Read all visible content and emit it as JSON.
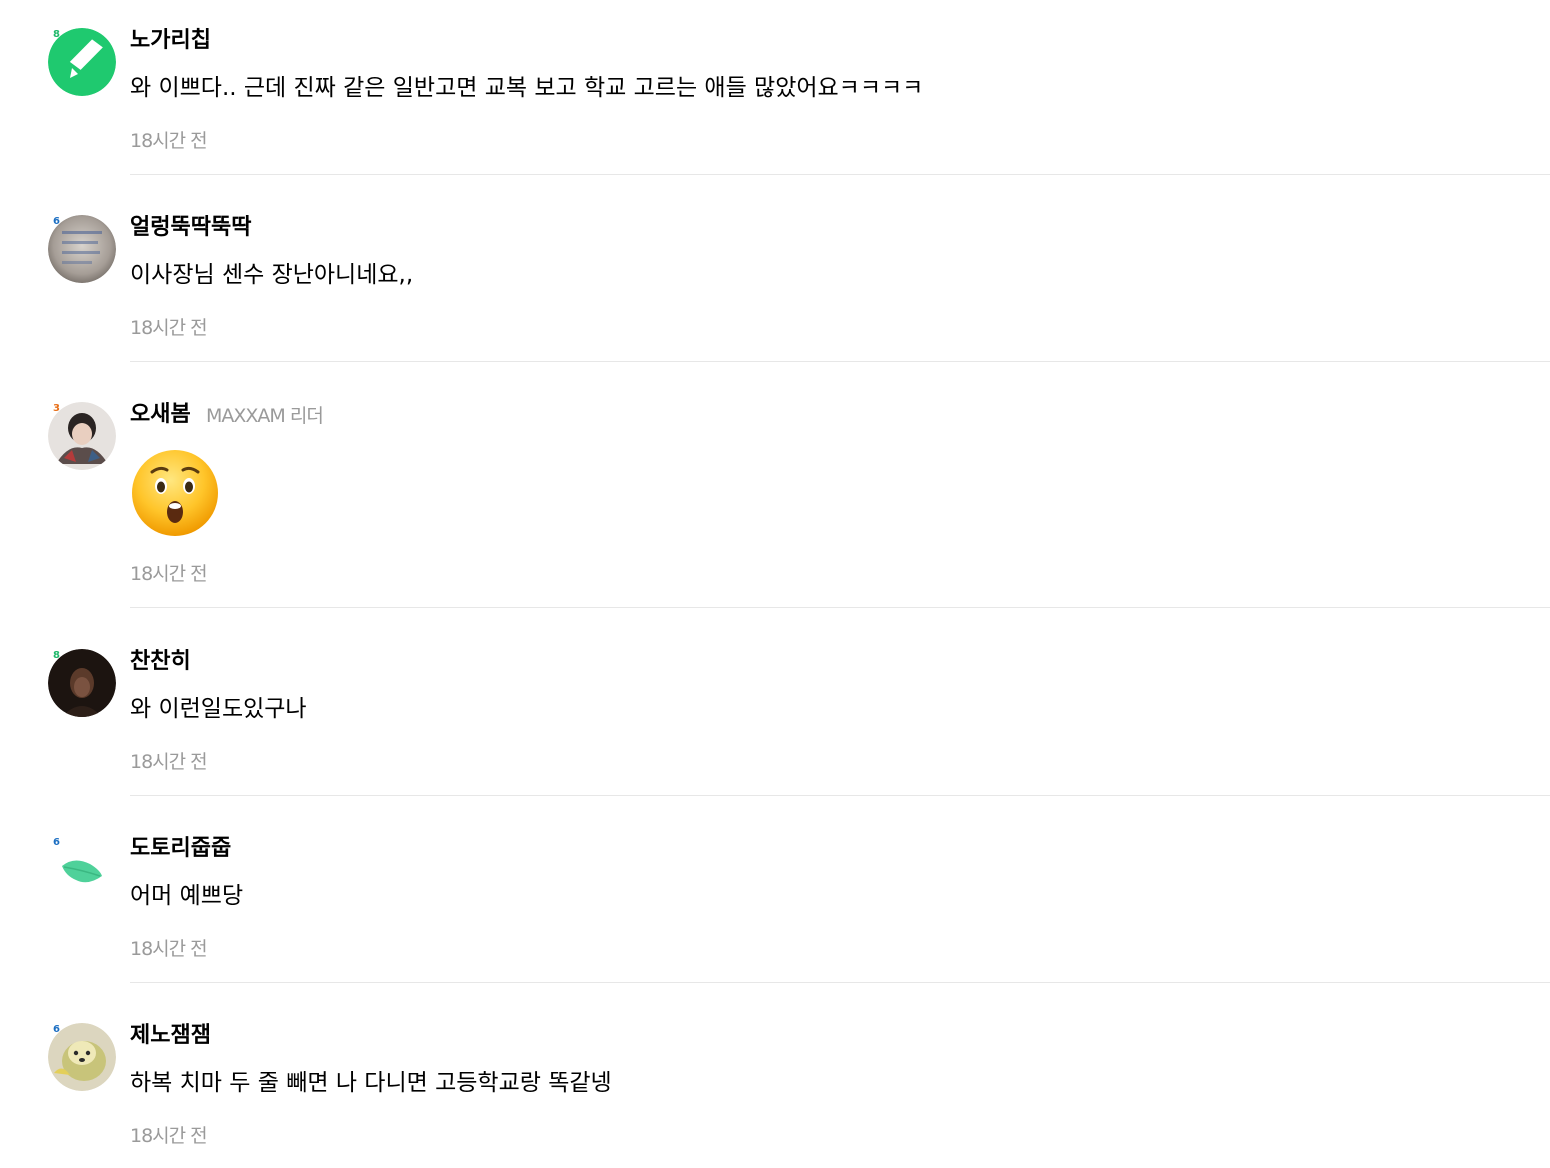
{
  "colors": {
    "nickname": "#000000",
    "content": "#000000",
    "meta": "#9a9a9a",
    "divider": "#e7e7e7",
    "badge_green": "#1fb86a",
    "badge_blue": "#1b6ec2",
    "badge_orange": "#e8701a"
  },
  "comments": [
    {
      "nickname": "노가리칩",
      "level_badge": "8",
      "avatar_icon": "green-check-icon",
      "content": "와 이쁘다.. 근데 진짜 같은 일반고면 교복 보고 학교 고르는 애들 많았어요ㅋㅋㅋㅋ",
      "timestamp": "18시간 전"
    },
    {
      "nickname": "얼렁뚝딱뚝딱",
      "level_badge": "6",
      "avatar_icon": "photo-avatar",
      "content": "이사장님 센수 장난아니네요,,",
      "timestamp": "18시간 전"
    },
    {
      "nickname": "오새봄",
      "role": "MAXXAM 리더",
      "level_badge": "3",
      "avatar_icon": "photo-avatar",
      "content_sticker": "astonished-face-emoji",
      "timestamp": "18시간 전"
    },
    {
      "nickname": "찬찬히",
      "level_badge": "8",
      "avatar_icon": "photo-avatar",
      "content": "와 이런일도있구나",
      "timestamp": "18시간 전"
    },
    {
      "nickname": "도토리줍줍",
      "level_badge": "6",
      "avatar_icon": "green-leaf-icon",
      "content": "어머 예쁘당",
      "timestamp": "18시간 전"
    },
    {
      "nickname": "제노잼잼",
      "level_badge": "6",
      "avatar_icon": "photo-avatar",
      "content": "하복 치마 두 줄 빼면 나 다니면 고등학교랑 똑같넹",
      "timestamp": "18시간 전"
    }
  ]
}
